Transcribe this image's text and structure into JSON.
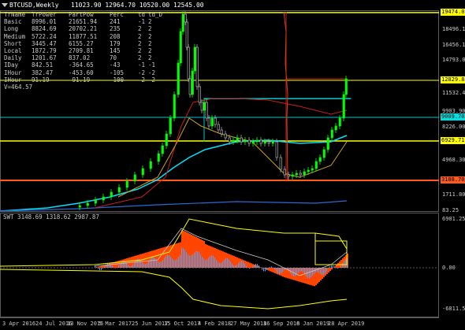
{
  "window": {
    "symbol": "BTCUSD,Weekly",
    "ohlc": "11023.90 12964.70 10520.00 12545.00",
    "menu_icon": "dropdown-triangle-icon"
  },
  "stats": {
    "headers": [
      "TrName",
      "TrPower",
      "PartPow",
      "Perc",
      "td",
      "td_D"
    ],
    "rows": [
      [
        "Basic",
        "8996.01",
        "21651.94",
        "241",
        "-1",
        "2"
      ],
      [
        "Long",
        "8824.69",
        "20702.21",
        "235",
        "2",
        "2"
      ],
      [
        "Medium",
        "5722.24",
        "11877.51",
        "208",
        "2",
        "2"
      ],
      [
        "Short",
        "3445.47",
        "6155.27",
        "179",
        "2",
        "2"
      ],
      [
        "Local",
        "1872.79",
        "2709.81",
        "145",
        "2",
        "2"
      ],
      [
        "Daily",
        "1201.67",
        "837.02",
        "70",
        "2",
        "2"
      ],
      [
        "IDay",
        "842.51",
        "-364.65",
        "-43",
        "-1",
        "-1"
      ],
      [
        "IHour",
        "382.47",
        "-453.60",
        "-105",
        "-2",
        "-2"
      ],
      [
        "IHour",
        "91.19",
        "-91.19",
        "-100",
        "-2",
        "-2"
      ]
    ],
    "v_line": "V=464.57"
  },
  "price_axis": {
    "labels": [
      "18496.10",
      "16456.10",
      "14793.05",
      "11532.45",
      "9903.90",
      "8226.00",
      "4968.30",
      "1711.80",
      "83.25"
    ],
    "tags": [
      {
        "text": "19474.00",
        "color": "#ffff00"
      },
      {
        "text": "12829.87",
        "color": "#ffff00"
      },
      {
        "text": "9009.70",
        "color": "#00e0e0"
      },
      {
        "text": "6929.71",
        "color": "#ffff00"
      },
      {
        "text": "3108.70",
        "color": "#ff5a1e"
      }
    ]
  },
  "oscillator": {
    "title": "SWT 3148.69 1318.62 2987.87",
    "labels": [
      "6901.25",
      "0.00",
      "-6811.59"
    ]
  },
  "time_axis": {
    "labels": [
      "3 Apr 2016",
      "24 Jul 2016",
      "13 Nov 2016",
      "5 Mar 2017",
      "25 Jun 2017",
      "15 Oct 2017",
      "4 Feb 2018",
      "27 May 2018",
      "16 Sep 2018",
      "6 Jan 2019",
      "28 Apr 2019"
    ]
  },
  "colors": {
    "background": "#000000",
    "bull_candle": "#00ff00",
    "level_yellow": "#ffff00",
    "level_cyan": "#00e0e0",
    "level_red": "#ff5a1e",
    "hist_orange": "#ff4500",
    "hist_blue": "#5aa0ff"
  }
}
